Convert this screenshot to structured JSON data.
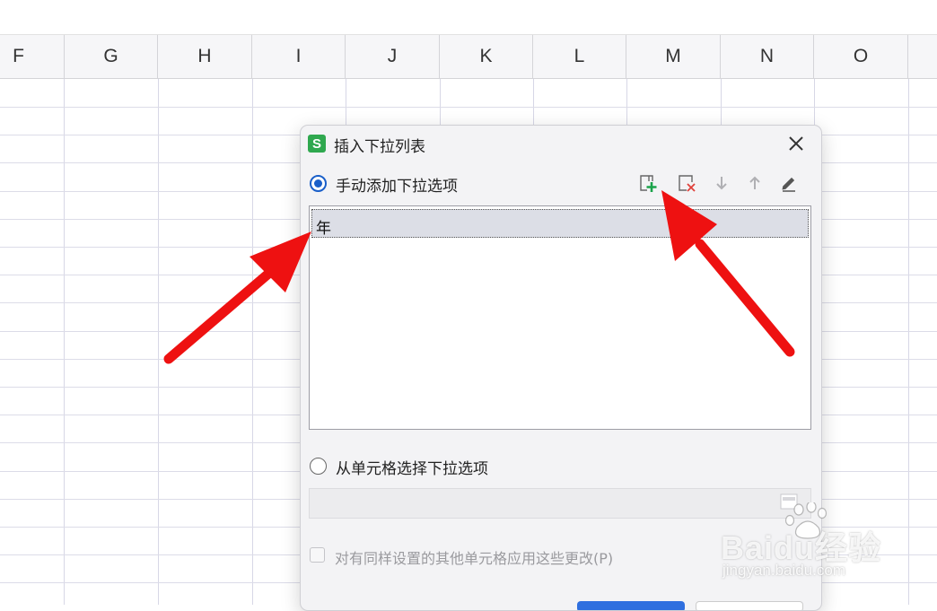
{
  "sheet": {
    "columns": [
      "F",
      "G",
      "H",
      "I",
      "J",
      "K",
      "L",
      "M",
      "N",
      "O"
    ]
  },
  "dialog": {
    "title": "插入下拉列表",
    "logo_letter": "S",
    "manual_option_label": "手动添加下拉选项",
    "manual_option_selected": true,
    "toolbar": {
      "icons": [
        "add-item-icon",
        "delete-item-icon",
        "move-down-icon",
        "move-up-icon",
        "edit-icon"
      ]
    },
    "list_items": [
      "年"
    ],
    "cell_option_label": "从单元格选择下拉选项",
    "apply_checkbox_label": "对有同样设置的其他单元格应用这些更改(P)",
    "apply_checkbox_checked": false
  },
  "watermark": {
    "brand": "Baidu经验",
    "url": "jingyan.baidu.com"
  },
  "colors": {
    "accent": "#1a5fc9",
    "logo_green": "#2fa84f",
    "add_icon_green": "#1aa34a",
    "delete_icon_red": "#e0403a",
    "annotation_arrow": "#ee1111"
  }
}
